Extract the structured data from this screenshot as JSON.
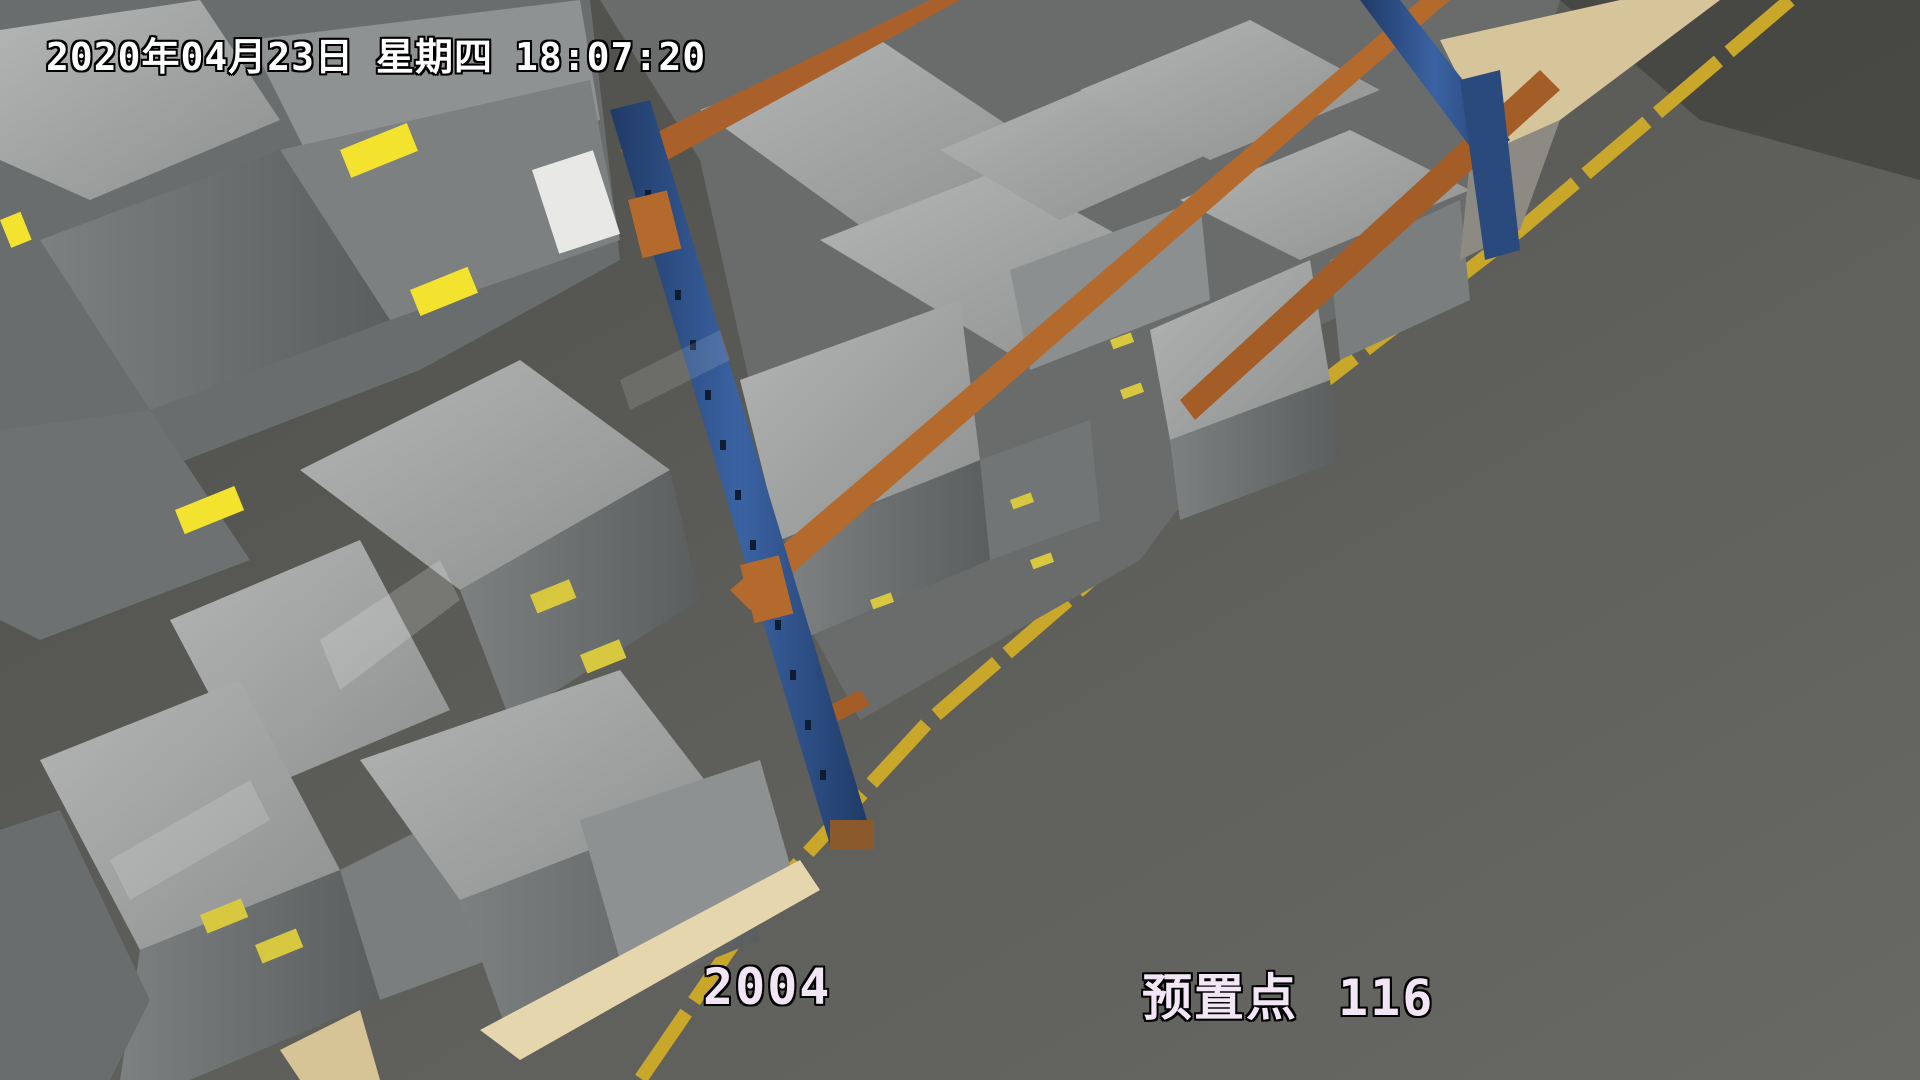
{
  "osd": {
    "date": "2020年04月23日",
    "weekday": "星期四",
    "time": "18:07:20",
    "camera_id": "2004",
    "preset_label": "预置点",
    "preset_number": "116"
  },
  "colors": {
    "floor": "#5c5c58",
    "floor_line": "#c9a72a",
    "rack_upright": "#2e4f86",
    "rack_beam": "#b9672a",
    "box_light": "#a9abab",
    "box_dark": "#6e7070",
    "label_yellow": "#f3e22e",
    "pallet_wood": "#e8d8b0"
  }
}
